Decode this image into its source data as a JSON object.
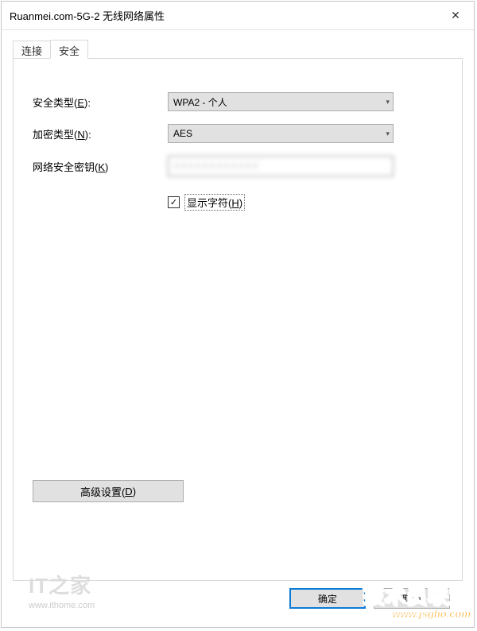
{
  "titlebar": {
    "title": "Ruanmei.com-5G-2 无线网络属性"
  },
  "tabs": {
    "connect": "连接",
    "security": "安全"
  },
  "form": {
    "security_type_label": "安全类型(E):",
    "security_type_value": "WPA2 - 个人",
    "encryption_type_label": "加密类型(N):",
    "encryption_type_value": "AES",
    "security_key_label": "网络安全密钥(K)",
    "security_key_value": "XXXXXXXXXXXX",
    "show_chars_label": "显示字符(H)"
  },
  "buttons": {
    "advanced": "高级设置(D)",
    "ok": "确定",
    "cancel": "取消"
  },
  "watermark": {
    "left_brand": "IT之家",
    "left_url": "www.ithome.com",
    "right_brand": "技术员联盟",
    "right_url": "www.jsgho.com"
  }
}
